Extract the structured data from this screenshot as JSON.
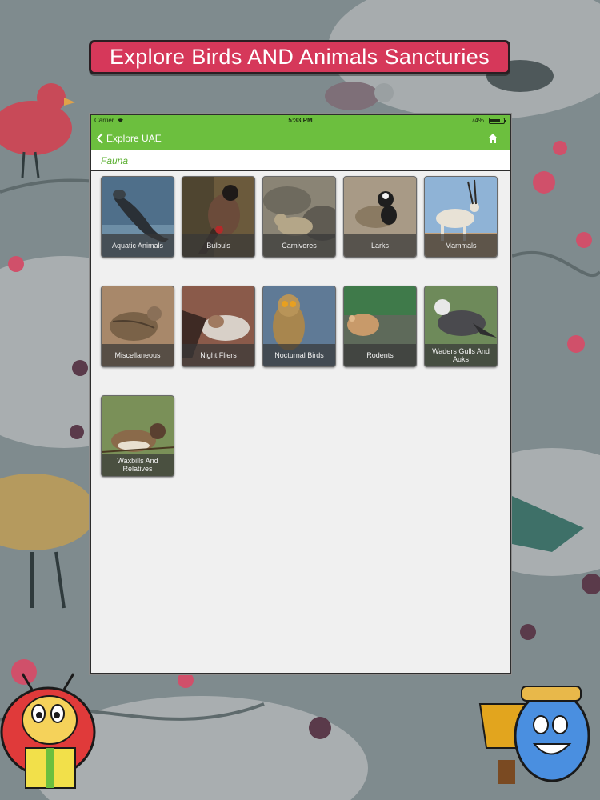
{
  "banner": {
    "title": "Explore Birds AND Animals Sancturies"
  },
  "statusbar": {
    "carrier": "Carrier",
    "time": "5:33 PM",
    "battery": "74%",
    "battery_level": 0.74,
    "wifi_icon": "wifi-icon"
  },
  "navbar": {
    "back_label": "Explore UAE",
    "back_icon": "chevron-left-icon",
    "home_icon": "home-icon"
  },
  "section": {
    "title": "Fauna"
  },
  "categories": [
    {
      "label": "Aquatic Animals"
    },
    {
      "label": "Bulbuls"
    },
    {
      "label": "Carnivores"
    },
    {
      "label": "Larks"
    },
    {
      "label": "Mammals"
    },
    {
      "label": "Miscellaneous"
    },
    {
      "label": "Night Fliers"
    },
    {
      "label": "Nocturnal Birds"
    },
    {
      "label": "Rodents"
    },
    {
      "label": "Waders Gulls And Auks"
    },
    {
      "label": "Waxbills And Relatives"
    }
  ],
  "colors": {
    "accent": "#6cbf3e",
    "banner": "#d6385a",
    "section_text": "#5cb032"
  }
}
